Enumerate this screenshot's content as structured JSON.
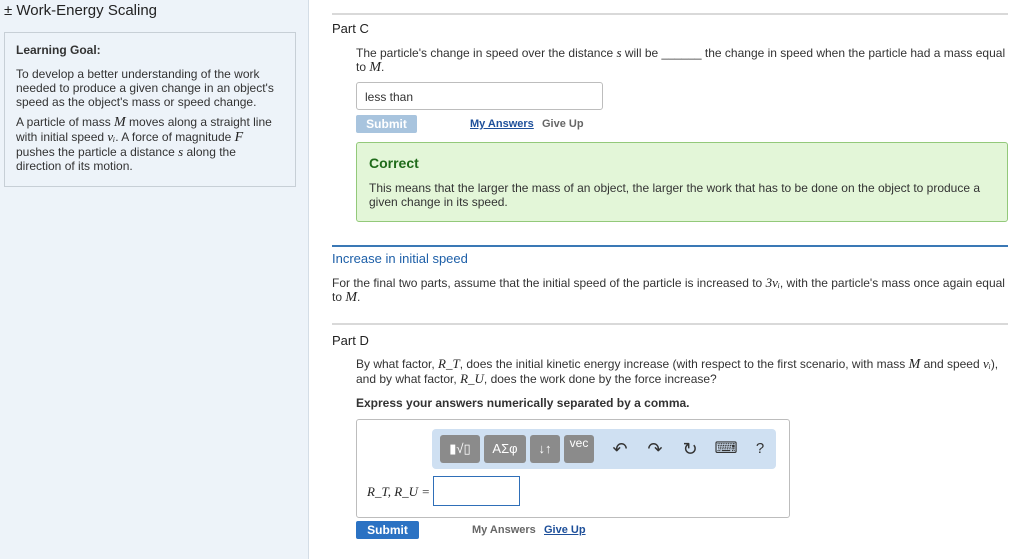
{
  "sidebar": {
    "title": "± Work-Energy Scaling",
    "goal_title": "Learning Goal:",
    "goal_text": "To develop a better understanding of the work needed to produce a given change in an object's speed as the object's mass or speed change.",
    "setup": {
      "t1": "A particle of mass ",
      "m": "M",
      "t2": " moves along a straight line with initial speed ",
      "v": "vᵢ",
      "t3": ". A force of magnitude ",
      "f": "F",
      "t4": " pushes the particle a distance ",
      "s": "s",
      "t5": " along the direction of its motion."
    }
  },
  "partC": {
    "title": "Part C",
    "q1": "The particle's change in speed over the distance ",
    "q_s": "s",
    "q2": " will be ______ the change in speed when the particle had a mass equal to ",
    "q_m": "M",
    "q3": ".",
    "answer": "less than",
    "submit": "Submit",
    "my_answers": "My Answers",
    "give_up": "Give Up"
  },
  "feedback": {
    "title": "Correct",
    "text": "This means that the larger the mass of an object, the larger the work that has to be done on the object to produce a given change in its speed."
  },
  "section": {
    "heading": "Increase in initial speed",
    "t1": "For the final two parts, assume that the initial speed of the particle is increased to ",
    "v": "3vᵢ",
    "t2": ", with the particle's mass once again equal to ",
    "m": "M",
    "t3": "."
  },
  "partD": {
    "title": "Part D",
    "q1": "By what factor, ",
    "rt": "R_T",
    "q2": ", does the initial kinetic energy increase (with respect to the first scenario, with mass ",
    "m": "M",
    "q3": " and speed ",
    "v": "vᵢ",
    "q4": "), and by what factor, ",
    "ru": "R_U",
    "q5": ", does the work done by the force increase?",
    "instruction": "Express your answers numerically separated by a comma.",
    "answer_label": "R_T, R_U =",
    "answer_value": "",
    "submit": "Submit",
    "my_answers": "My Answers",
    "give_up": "Give Up"
  },
  "toolbar": {
    "templates_label": "▮√▯",
    "greek_label": "ΑΣφ",
    "arrows_label": "↓↑",
    "vec_label": "vec",
    "undo_icon": "↶",
    "redo_icon": "↷",
    "reset_icon": "↻",
    "keyboard_icon": "⌨",
    "help_label": "?"
  },
  "colors": {
    "sidebar_bg": "#edf3f9",
    "correct_bg": "#e3f6d8",
    "correct_title": "#1f6b1a",
    "accent_blue": "#2b72c3",
    "heading_blue": "#1d5fa8"
  }
}
